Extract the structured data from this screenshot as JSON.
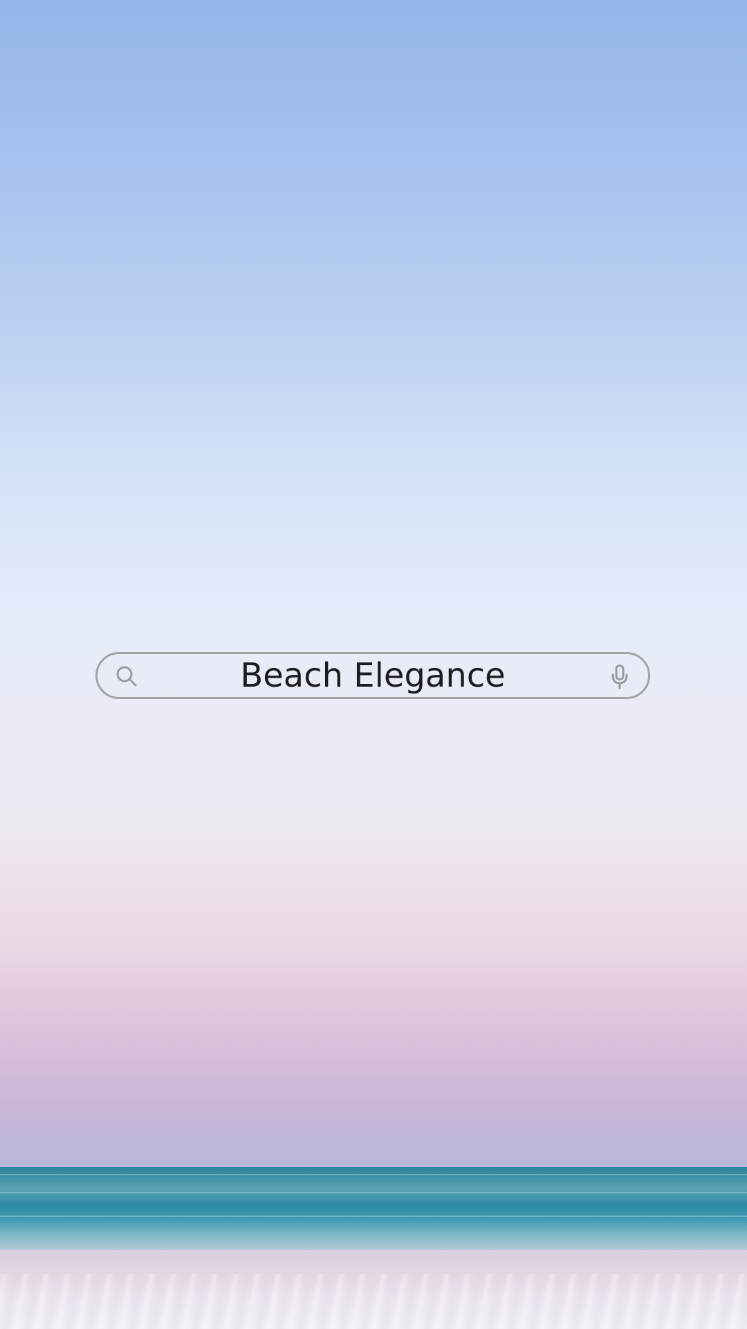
{
  "search": {
    "value": "Beach Elegance",
    "search_icon": "search-icon",
    "mic_icon": "microphone-icon"
  },
  "colors": {
    "bar_border": "#a3a3a5",
    "text": "#1c1c1e",
    "icon": "#9a9a9c"
  }
}
